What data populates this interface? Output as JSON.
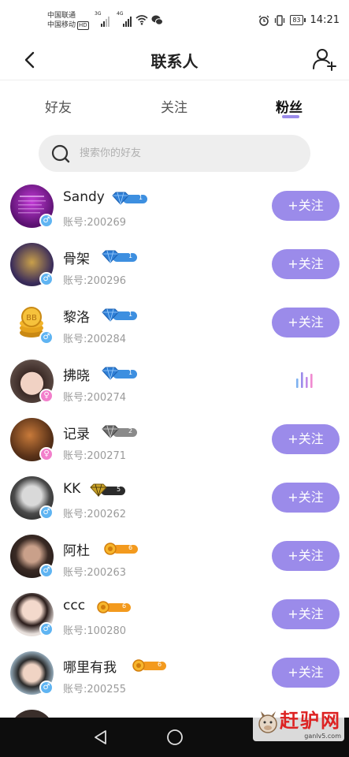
{
  "status": {
    "carrier1": "中国联通",
    "carrier2": "中国移动",
    "hd": "HD",
    "net1": "3G",
    "net2": "4G",
    "battery": "83",
    "time": "14:21"
  },
  "header": {
    "title": "联系人"
  },
  "tabs": [
    {
      "label": "好友",
      "active": false
    },
    {
      "label": "关注",
      "active": false
    },
    {
      "label": "粉丝",
      "active": true
    }
  ],
  "search": {
    "placeholder": "搜索你的好友"
  },
  "contacts": [
    {
      "name": "Sandy",
      "account": "账号:200269",
      "gender": "♂",
      "badge_level": "1",
      "badge_type": "blue-diamond",
      "action": "+关注"
    },
    {
      "name": "骨架",
      "account": "账号:200296",
      "gender": "♂",
      "badge_level": "1",
      "badge_type": "blue-diamond",
      "action": "+关注"
    },
    {
      "name": "黎洛",
      "account": "账号:200284",
      "gender": "♂",
      "badge_level": "1",
      "badge_type": "blue-diamond",
      "action": "+关注"
    },
    {
      "name": "拂晓",
      "account": "账号:200274",
      "gender": "♀",
      "badge_level": "1",
      "badge_type": "blue-diamond",
      "action": ""
    },
    {
      "name": "记录",
      "account": "账号:200271",
      "gender": "♀",
      "badge_level": "2",
      "badge_type": "gray-diamond",
      "action": "+关注"
    },
    {
      "name": "KK",
      "account": "账号:200262",
      "gender": "♂",
      "badge_level": "5",
      "badge_type": "black-diamond",
      "action": "+关注"
    },
    {
      "name": "阿杜",
      "account": "账号:200263",
      "gender": "♂",
      "badge_level": "6",
      "badge_type": "gold-sun",
      "action": "+关注"
    },
    {
      "name": "ccc",
      "account": "账号:100280",
      "gender": "♂",
      "badge_level": "6",
      "badge_type": "gold-sun",
      "action": "+关注"
    },
    {
      "name": "哪里有我",
      "account": "账号:200255",
      "gender": "♂",
      "badge_level": "6",
      "badge_type": "gold-sun",
      "action": "+关注"
    }
  ],
  "watermark": {
    "text": "赶驴网",
    "url": "ganlv5.com"
  },
  "colors": {
    "accent": "#9b8bea",
    "male": "#5fb4f2",
    "female": "#f27fcb"
  }
}
